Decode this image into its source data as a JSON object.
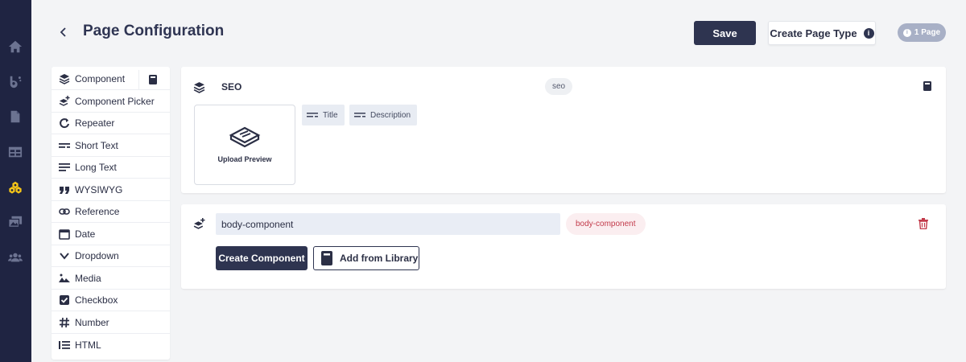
{
  "colors": {
    "rail": "#1f2442",
    "accent_dark": "#2e3450",
    "danger": "#c23a4a",
    "rail_active": "#f5c518"
  },
  "rail": {
    "items": [
      {
        "icon": "home-icon"
      },
      {
        "icon": "blog-icon"
      },
      {
        "icon": "document-icon"
      },
      {
        "icon": "table-icon"
      },
      {
        "icon": "components-icon",
        "active": true
      },
      {
        "icon": "media-icon"
      },
      {
        "icon": "users-icon"
      }
    ]
  },
  "header": {
    "title": "Page Configuration",
    "save_label": "Save",
    "create_page_type_label": "Create Page Type",
    "pages_badge": "1 Page"
  },
  "field_types": [
    {
      "label": "Component",
      "icon": "layers-icon"
    },
    {
      "label": "Component Picker",
      "icon": "layers-plus-icon"
    },
    {
      "label": "Repeater",
      "icon": "repeat-icon"
    },
    {
      "label": "Short Text",
      "icon": "short-text-icon"
    },
    {
      "label": "Long Text",
      "icon": "long-text-icon"
    },
    {
      "label": "WYSIWYG",
      "icon": "quote-icon"
    },
    {
      "label": "Reference",
      "icon": "link-icon"
    },
    {
      "label": "Date",
      "icon": "calendar-icon"
    },
    {
      "label": "Dropdown",
      "icon": "chevron-down-icon"
    },
    {
      "label": "Media",
      "icon": "image-icon"
    },
    {
      "label": "Checkbox",
      "icon": "checkbox-icon"
    },
    {
      "label": "Number",
      "icon": "hash-icon"
    },
    {
      "label": "HTML",
      "icon": "list-icon"
    }
  ],
  "seo_card": {
    "title": "SEO",
    "key": "seo",
    "upload_label": "Upload Preview",
    "fields": [
      {
        "label": "Title"
      },
      {
        "label": "Description"
      }
    ]
  },
  "component_card": {
    "name_value": "body-component",
    "key": "body-component",
    "create_label": "Create Component",
    "library_label": "Add from Library"
  }
}
